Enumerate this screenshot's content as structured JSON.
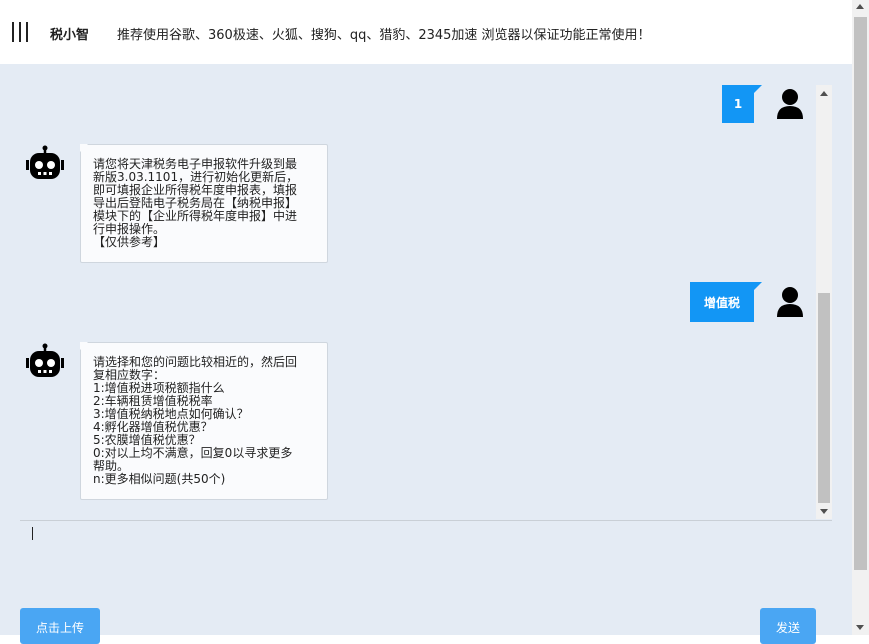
{
  "header": {
    "app_title": "税小智",
    "notice": "推荐使用谷歌、360极速、火狐、搜狗、qq、猎豹、2345加速 浏览器以保证功能正常使用！"
  },
  "messages": [
    {
      "role": "user",
      "text": "1"
    },
    {
      "role": "bot",
      "lines": [
        "请您将天津税务电子申报软件升级到最",
        "新版3.03.1101，进行初始化更新后，",
        "即可填报企业所得税年度申报表，填报",
        "导出后登陆电子税务局在【纳税申报】",
        "模块下的【企业所得税年度申报】中进",
        "行申报操作。",
        "【仅供参考】"
      ]
    },
    {
      "role": "user",
      "text": "增值税"
    },
    {
      "role": "bot",
      "lines": [
        "请选择和您的问题比较相近的，然后回",
        "复相应数字：",
        "1:增值税进项税额指什么",
        "2:车辆租赁增值税税率",
        "3:增值税纳税地点如何确认？",
        "4:孵化器增值税优惠？",
        "5:农膜增值税优惠？",
        "0:对以上均不满意，回复0以寻求更多",
        "帮助。",
        "n:更多相似问题(共50个)"
      ]
    }
  ],
  "footer": {
    "upload_label": "点击上传",
    "send_label": "发送"
  },
  "colors": {
    "accent": "#1296f5",
    "button": "#4aa6f3",
    "background": "#e4ebf4"
  }
}
